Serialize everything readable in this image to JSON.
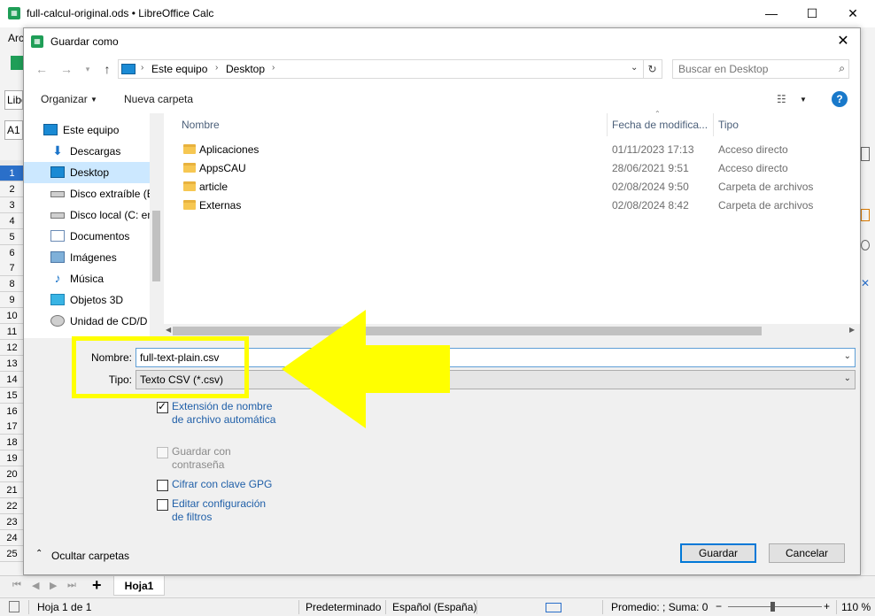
{
  "calc": {
    "window_title": "full-calcul-original.ods • LibreOffice Calc",
    "app_icon": "calc-icon",
    "menu_partial": "Arc",
    "font_partial": "Libe",
    "cell_ref": "A1",
    "rows": [
      "1",
      "2",
      "3",
      "4",
      "5",
      "6",
      "7",
      "8",
      "9",
      "10",
      "11",
      "12",
      "13",
      "14",
      "15",
      "16",
      "17",
      "18",
      "19",
      "20",
      "21",
      "22",
      "23",
      "24",
      "25"
    ],
    "sheet_tab": "Hoja1",
    "status": {
      "sheet": "Hoja 1 de 1",
      "style": "Predeterminado",
      "language": "Español (España)",
      "summary": "Promedio: ; Suma: 0",
      "zoom": "110 %"
    }
  },
  "dialog": {
    "title": "Guardar como",
    "nav": {
      "path": [
        "Este equipo",
        "Desktop"
      ],
      "search_placeholder": "Buscar en Desktop"
    },
    "toolbar": {
      "organize": "Organizar",
      "new_folder": "Nueva carpeta"
    },
    "sidebar": [
      {
        "label": "Este equipo",
        "icon": "computer-icon"
      },
      {
        "label": "Descargas",
        "icon": "download-icon"
      },
      {
        "label": "Desktop",
        "icon": "desktop-icon",
        "selected": true
      },
      {
        "label": "Disco extraíble (E",
        "icon": "removable-drive-icon"
      },
      {
        "label": "Disco local (C: en",
        "icon": "local-drive-icon"
      },
      {
        "label": "Documentos",
        "icon": "documents-icon"
      },
      {
        "label": "Imágenes",
        "icon": "pictures-icon"
      },
      {
        "label": "Música",
        "icon": "music-icon"
      },
      {
        "label": "Objetos 3D",
        "icon": "3d-objects-icon"
      },
      {
        "label": "Unidad de CD/D",
        "icon": "cd-drive-icon"
      }
    ],
    "columns": {
      "name": "Nombre",
      "date": "Fecha de modifica...",
      "type": "Tipo"
    },
    "files": [
      {
        "name": "Aplicaciones",
        "date": "01/11/2023 17:13",
        "type": "Acceso directo"
      },
      {
        "name": "AppsCAU",
        "date": "28/06/2021 9:51",
        "type": "Acceso directo"
      },
      {
        "name": "article",
        "date": "02/08/2024 9:50",
        "type": "Carpeta de archivos"
      },
      {
        "name": "Externas",
        "date": "02/08/2024 8:42",
        "type": "Carpeta de archivos"
      }
    ],
    "form": {
      "name_label": "Nombre:",
      "name_value": "full-text-plain.csv",
      "type_label": "Tipo:",
      "type_value": "Texto CSV (*.csv)"
    },
    "options": {
      "auto_ext": "Extensión de nombre de archivo automática",
      "password": "Guardar con contraseña",
      "gpg": "Cifrar con clave GPG",
      "filters": "Editar configuración de filtros"
    },
    "hide_folders": "Ocultar carpetas",
    "save_button": "Guardar",
    "cancel_button": "Cancelar"
  },
  "colors": {
    "annotation": "#ffff00",
    "selection": "#cce8ff",
    "link": "#1f5fa8",
    "accent": "#0078d7"
  }
}
